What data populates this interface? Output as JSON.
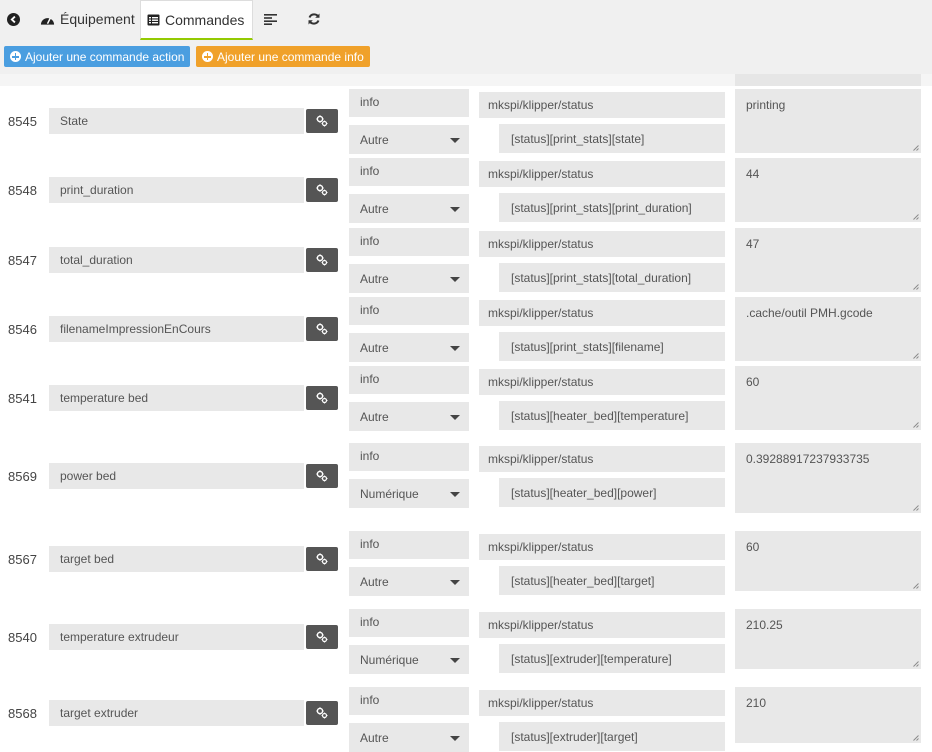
{
  "tabs": {
    "back_icon": "arrow-left-icon",
    "equipement": "Équipement",
    "commandes": "Commandes",
    "list_icon": "align-left-icon",
    "refresh_icon": "refresh-icon"
  },
  "buttons": {
    "add_action": "Ajouter une commande action",
    "add_info": "Ajouter une commande info"
  },
  "rows": [
    {
      "id": "8545",
      "name": "State",
      "type": "info",
      "subtype": "Autre",
      "topic": "mkspi/klipper/status",
      "path": "[status][print_stats][state]",
      "value": "printing"
    },
    {
      "id": "8548",
      "name": "print_duration",
      "type": "info",
      "subtype": "Autre",
      "topic": "mkspi/klipper/status",
      "path": "[status][print_stats][print_duration]",
      "value": "44"
    },
    {
      "id": "8547",
      "name": "total_duration",
      "type": "info",
      "subtype": "Autre",
      "topic": "mkspi/klipper/status",
      "path": "[status][print_stats][total_duration]",
      "value": "47"
    },
    {
      "id": "8546",
      "name": "filenameImpressionEnCours",
      "type": "info",
      "subtype": "Autre",
      "topic": "mkspi/klipper/status",
      "path": "[status][print_stats][filename]",
      "value": ".cache/outil PMH.gcode"
    },
    {
      "id": "8541",
      "name": "temperature bed",
      "type": "info",
      "subtype": "Autre",
      "topic": "mkspi/klipper/status",
      "path": "[status][heater_bed][temperature]",
      "value": "60"
    },
    {
      "id": "8569",
      "name": "power bed",
      "type": "info",
      "subtype": "Numérique",
      "topic": "mkspi/klipper/status",
      "path": "[status][heater_bed][power]",
      "value": "0.39288917237933735"
    },
    {
      "id": "8567",
      "name": "target bed",
      "type": "info",
      "subtype": "Autre",
      "topic": "mkspi/klipper/status",
      "path": "[status][heater_bed][target]",
      "value": "60"
    },
    {
      "id": "8540",
      "name": "temperature extrudeur",
      "type": "info",
      "subtype": "Numérique",
      "topic": "mkspi/klipper/status",
      "path": "[status][extruder][temperature]",
      "value": "210.25"
    },
    {
      "id": "8568",
      "name": "target extruder",
      "type": "info",
      "subtype": "Autre",
      "topic": "mkspi/klipper/status",
      "path": "[status][extruder][target]",
      "value": "210"
    }
  ],
  "colors": {
    "accent_green": "#94ca02",
    "button_blue": "#4a9ee0",
    "button_orange": "#f0a12a",
    "config_button": "#555555"
  }
}
